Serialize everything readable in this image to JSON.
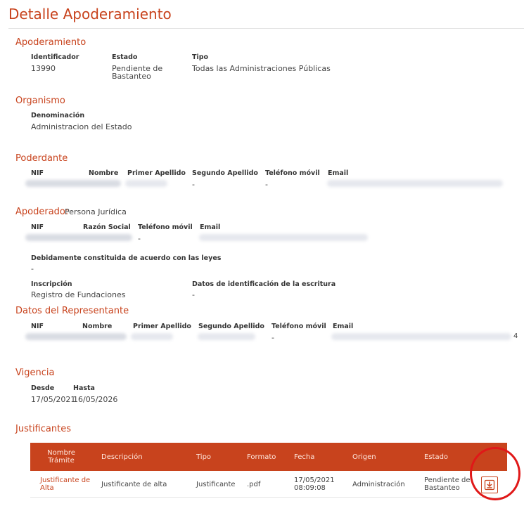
{
  "page": {
    "title": "Detalle Apoderamiento"
  },
  "apoderamiento": {
    "title": "Apoderamiento",
    "labels": {
      "identificador": "Identificador",
      "estado": "Estado",
      "tipo": "Tipo"
    },
    "values": {
      "identificador": "13990",
      "estado_line1": "Pendiente de",
      "estado_line2": "Bastanteo",
      "tipo": "Todas las Administraciones Públicas"
    }
  },
  "organismo": {
    "title": "Organismo",
    "labels": {
      "denominacion": "Denominación"
    },
    "values": {
      "denominacion": "Administracion del Estado"
    }
  },
  "poderdante": {
    "title": "Poderdante",
    "labels": {
      "nif": "NIF",
      "nombre": "Nombre",
      "primer_apellido": "Primer Apellido",
      "segundo_apellido": "Segundo Apellido",
      "telefono": "Teléfono móvil",
      "email": "Email"
    },
    "values": {
      "segundo_apellido": "-",
      "telefono": "-"
    }
  },
  "apoderado": {
    "title": "Apoderado:",
    "type": "Persona Jurídica",
    "labels": {
      "nif": "NIF",
      "razon_social": "Razón Social",
      "telefono": "Teléfono móvil",
      "email": "Email",
      "constituida": "Debidamente constituida de acuerdo con las leyes",
      "inscripcion": "Inscripción",
      "datos_escritura": "Datos de identificación de la escritura"
    },
    "values": {
      "telefono": "-",
      "constituida": "-",
      "inscripcion": "Registro de Fundaciones",
      "datos_escritura": "-"
    }
  },
  "representante": {
    "title": "Datos del Representante",
    "labels": {
      "nif": "NIF",
      "nombre": "Nombre",
      "primer_apellido": "Primer Apellido",
      "segundo_apellido": "Segundo Apellido",
      "telefono": "Teléfono móvil",
      "email": "Email"
    },
    "values": {
      "telefono": "-",
      "trailing": "4"
    }
  },
  "vigencia": {
    "title": "Vigencia",
    "labels": {
      "desde": "Desde",
      "hasta": "Hasta"
    },
    "values": {
      "desde": "17/05/2021",
      "hasta": "16/05/2026"
    }
  },
  "justificantes": {
    "title": "Justificantes",
    "headers": {
      "nombre_l1": "Nombre",
      "nombre_l2": "Trámite",
      "descripcion": "Descripción",
      "tipo": "Tipo",
      "formato": "Formato",
      "fecha": "Fecha",
      "origen": "Origen",
      "estado": "Estado"
    },
    "rows": [
      {
        "nombre_l1": "Justificante de",
        "nombre_l2": "Alta",
        "descripcion": "Justificante de alta",
        "tipo": "Justificante",
        "formato": ".pdf",
        "fecha_l1": "17/05/2021",
        "fecha_l2": "08:09:08",
        "origen": "Administración",
        "estado_l1": "Pendiente de",
        "estado_l2": "Bastanteo"
      }
    ]
  },
  "colors": {
    "accent": "#c8431d",
    "highlight": "#e01818"
  },
  "icons": {
    "download": "download-pdf-icon"
  }
}
